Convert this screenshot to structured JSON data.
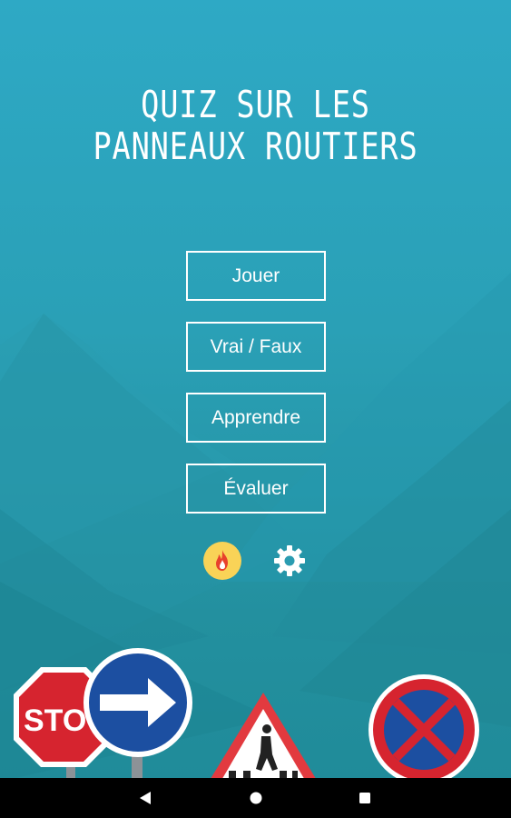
{
  "app": {
    "title_line1": "QUIZ SUR LES",
    "title_line2": "PANNEAUX ROUTIERS"
  },
  "menu": {
    "items": [
      {
        "label": "Jouer"
      },
      {
        "label": "Vrai / Faux"
      },
      {
        "label": "Apprendre"
      },
      {
        "label": "Évaluer"
      }
    ]
  },
  "icons": {
    "streak": "fire-icon",
    "settings": "gear-icon"
  },
  "signs": {
    "stop_text": "STO"
  },
  "navbar": {
    "back": "back-icon",
    "home": "home-icon",
    "recents": "recents-icon"
  },
  "colors": {
    "background": "#2aa1b8",
    "fire_circle": "#f9d357",
    "fire_flame": "#e8412c",
    "stop_red": "#d6242f",
    "sign_blue": "#1c4fa1"
  }
}
